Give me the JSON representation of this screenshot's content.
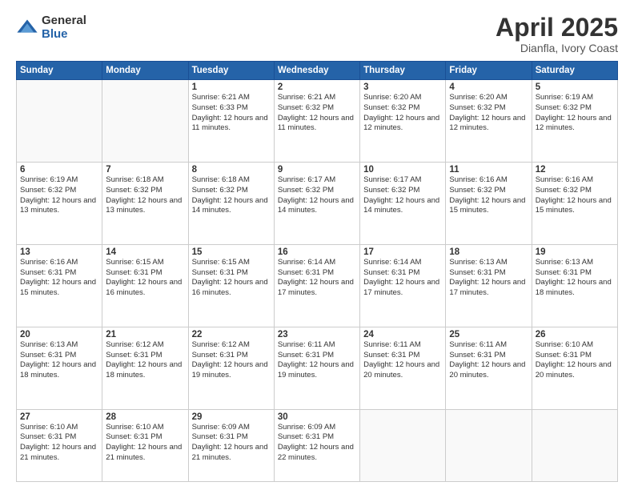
{
  "logo": {
    "general": "General",
    "blue": "Blue"
  },
  "title": "April 2025",
  "subtitle": "Dianfla, Ivory Coast",
  "days_of_week": [
    "Sunday",
    "Monday",
    "Tuesday",
    "Wednesday",
    "Thursday",
    "Friday",
    "Saturday"
  ],
  "weeks": [
    [
      {
        "num": "",
        "info": ""
      },
      {
        "num": "",
        "info": ""
      },
      {
        "num": "1",
        "info": "Sunrise: 6:21 AM\nSunset: 6:33 PM\nDaylight: 12 hours and 11 minutes."
      },
      {
        "num": "2",
        "info": "Sunrise: 6:21 AM\nSunset: 6:32 PM\nDaylight: 12 hours and 11 minutes."
      },
      {
        "num": "3",
        "info": "Sunrise: 6:20 AM\nSunset: 6:32 PM\nDaylight: 12 hours and 12 minutes."
      },
      {
        "num": "4",
        "info": "Sunrise: 6:20 AM\nSunset: 6:32 PM\nDaylight: 12 hours and 12 minutes."
      },
      {
        "num": "5",
        "info": "Sunrise: 6:19 AM\nSunset: 6:32 PM\nDaylight: 12 hours and 12 minutes."
      }
    ],
    [
      {
        "num": "6",
        "info": "Sunrise: 6:19 AM\nSunset: 6:32 PM\nDaylight: 12 hours and 13 minutes."
      },
      {
        "num": "7",
        "info": "Sunrise: 6:18 AM\nSunset: 6:32 PM\nDaylight: 12 hours and 13 minutes."
      },
      {
        "num": "8",
        "info": "Sunrise: 6:18 AM\nSunset: 6:32 PM\nDaylight: 12 hours and 14 minutes."
      },
      {
        "num": "9",
        "info": "Sunrise: 6:17 AM\nSunset: 6:32 PM\nDaylight: 12 hours and 14 minutes."
      },
      {
        "num": "10",
        "info": "Sunrise: 6:17 AM\nSunset: 6:32 PM\nDaylight: 12 hours and 14 minutes."
      },
      {
        "num": "11",
        "info": "Sunrise: 6:16 AM\nSunset: 6:32 PM\nDaylight: 12 hours and 15 minutes."
      },
      {
        "num": "12",
        "info": "Sunrise: 6:16 AM\nSunset: 6:32 PM\nDaylight: 12 hours and 15 minutes."
      }
    ],
    [
      {
        "num": "13",
        "info": "Sunrise: 6:16 AM\nSunset: 6:31 PM\nDaylight: 12 hours and 15 minutes."
      },
      {
        "num": "14",
        "info": "Sunrise: 6:15 AM\nSunset: 6:31 PM\nDaylight: 12 hours and 16 minutes."
      },
      {
        "num": "15",
        "info": "Sunrise: 6:15 AM\nSunset: 6:31 PM\nDaylight: 12 hours and 16 minutes."
      },
      {
        "num": "16",
        "info": "Sunrise: 6:14 AM\nSunset: 6:31 PM\nDaylight: 12 hours and 17 minutes."
      },
      {
        "num": "17",
        "info": "Sunrise: 6:14 AM\nSunset: 6:31 PM\nDaylight: 12 hours and 17 minutes."
      },
      {
        "num": "18",
        "info": "Sunrise: 6:13 AM\nSunset: 6:31 PM\nDaylight: 12 hours and 17 minutes."
      },
      {
        "num": "19",
        "info": "Sunrise: 6:13 AM\nSunset: 6:31 PM\nDaylight: 12 hours and 18 minutes."
      }
    ],
    [
      {
        "num": "20",
        "info": "Sunrise: 6:13 AM\nSunset: 6:31 PM\nDaylight: 12 hours and 18 minutes."
      },
      {
        "num": "21",
        "info": "Sunrise: 6:12 AM\nSunset: 6:31 PM\nDaylight: 12 hours and 18 minutes."
      },
      {
        "num": "22",
        "info": "Sunrise: 6:12 AM\nSunset: 6:31 PM\nDaylight: 12 hours and 19 minutes."
      },
      {
        "num": "23",
        "info": "Sunrise: 6:11 AM\nSunset: 6:31 PM\nDaylight: 12 hours and 19 minutes."
      },
      {
        "num": "24",
        "info": "Sunrise: 6:11 AM\nSunset: 6:31 PM\nDaylight: 12 hours and 20 minutes."
      },
      {
        "num": "25",
        "info": "Sunrise: 6:11 AM\nSunset: 6:31 PM\nDaylight: 12 hours and 20 minutes."
      },
      {
        "num": "26",
        "info": "Sunrise: 6:10 AM\nSunset: 6:31 PM\nDaylight: 12 hours and 20 minutes."
      }
    ],
    [
      {
        "num": "27",
        "info": "Sunrise: 6:10 AM\nSunset: 6:31 PM\nDaylight: 12 hours and 21 minutes."
      },
      {
        "num": "28",
        "info": "Sunrise: 6:10 AM\nSunset: 6:31 PM\nDaylight: 12 hours and 21 minutes."
      },
      {
        "num": "29",
        "info": "Sunrise: 6:09 AM\nSunset: 6:31 PM\nDaylight: 12 hours and 21 minutes."
      },
      {
        "num": "30",
        "info": "Sunrise: 6:09 AM\nSunset: 6:31 PM\nDaylight: 12 hours and 22 minutes."
      },
      {
        "num": "",
        "info": ""
      },
      {
        "num": "",
        "info": ""
      },
      {
        "num": "",
        "info": ""
      }
    ]
  ]
}
